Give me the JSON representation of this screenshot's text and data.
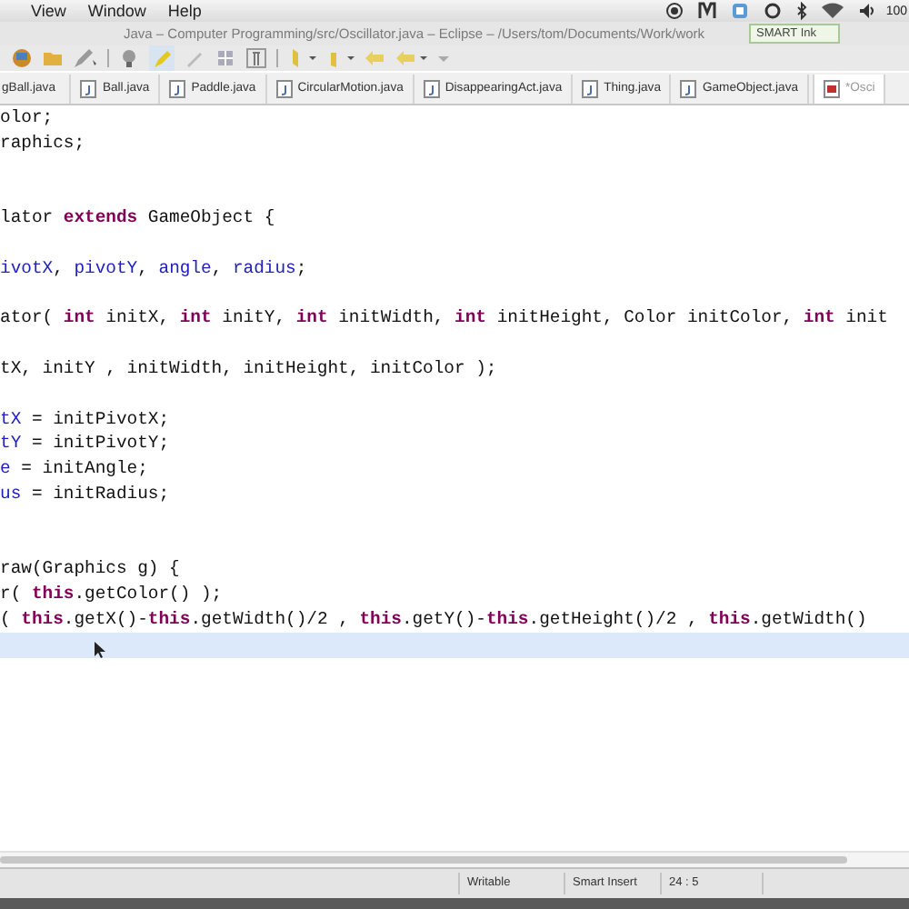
{
  "menu_bar": {
    "items": [
      "View",
      "Window",
      "Help"
    ],
    "battery": "100"
  },
  "window": {
    "title": "Java – Computer Programming/src/Oscillator.java – Eclipse – /Users/tom/Documents/Work/work"
  },
  "smart_ink": {
    "label": "SMART Ink"
  },
  "tabs": [
    {
      "label": "gBall.java",
      "selected": false
    },
    {
      "label": "Ball.java",
      "selected": false
    },
    {
      "label": "Paddle.java",
      "selected": false
    },
    {
      "label": "CircularMotion.java",
      "selected": false
    },
    {
      "label": "DisappearingAct.java",
      "selected": false
    },
    {
      "label": "Thing.java",
      "selected": false
    },
    {
      "label": "GameObject.java",
      "selected": false
    },
    {
      "label": "*Osci",
      "selected": true
    }
  ],
  "editor": {
    "lines": [
      {
        "current": false,
        "segments": [
          {
            "kind": "plain",
            "text": "olor;"
          }
        ]
      },
      {
        "current": false,
        "segments": [
          {
            "kind": "plain",
            "text": "raphics;"
          }
        ]
      },
      {
        "current": false
      },
      {
        "current": false
      },
      {
        "current": false,
        "segments": [
          {
            "kind": "plain",
            "text": "lator "
          },
          {
            "kind": "keyword",
            "text": "extends"
          },
          {
            "kind": "plain",
            "text": " GameObject {"
          }
        ]
      },
      {
        "current": false
      },
      {
        "current": false,
        "segments": [
          {
            "kind": "field",
            "text": "ivotX"
          },
          {
            "kind": "plain",
            "text": ", "
          },
          {
            "kind": "field",
            "text": "pivotY"
          },
          {
            "kind": "plain",
            "text": ", "
          },
          {
            "kind": "field",
            "text": "angle"
          },
          {
            "kind": "plain",
            "text": ", "
          },
          {
            "kind": "field",
            "text": "radius"
          },
          {
            "kind": "plain",
            "text": ";"
          }
        ]
      },
      {
        "current": false
      },
      {
        "current": false,
        "segments": [
          {
            "kind": "plain",
            "text": "ator( "
          },
          {
            "kind": "keyword",
            "text": "int"
          },
          {
            "kind": "plain",
            "text": " initX, "
          },
          {
            "kind": "keyword",
            "text": "int"
          },
          {
            "kind": "plain",
            "text": " initY, "
          },
          {
            "kind": "keyword",
            "text": "int"
          },
          {
            "kind": "plain",
            "text": " initWidth, "
          },
          {
            "kind": "keyword",
            "text": "int"
          },
          {
            "kind": "plain",
            "text": " initHeight, Color initColor, "
          },
          {
            "kind": "keyword",
            "text": "int"
          },
          {
            "kind": "plain",
            "text": " init"
          }
        ]
      },
      {
        "current": false
      },
      {
        "current": false,
        "segments": [
          {
            "kind": "plain",
            "text": "tX, initY , initWidth, initHeight, initColor );"
          }
        ]
      },
      {
        "current": false
      },
      {
        "current": false,
        "segments": [
          {
            "kind": "field",
            "text": "tX"
          },
          {
            "kind": "plain",
            "text": " = initPivotX;"
          }
        ]
      },
      {
        "current": false,
        "segments": [
          {
            "kind": "field",
            "text": "tY"
          },
          {
            "kind": "plain",
            "text": " = initPivotY;"
          }
        ]
      },
      {
        "current": false,
        "segments": [
          {
            "kind": "field",
            "text": "e"
          },
          {
            "kind": "plain",
            "text": " = initAngle;"
          }
        ]
      },
      {
        "current": false,
        "segments": [
          {
            "kind": "field",
            "text": "us"
          },
          {
            "kind": "plain",
            "text": " = initRadius;"
          }
        ]
      },
      {
        "current": false
      },
      {
        "current": false
      },
      {
        "current": false,
        "segments": [
          {
            "kind": "plain",
            "text": "raw(Graphics g) {"
          }
        ]
      },
      {
        "current": false,
        "segments": [
          {
            "kind": "plain",
            "text": "r( "
          },
          {
            "kind": "keyword",
            "text": "this"
          },
          {
            "kind": "plain",
            "text": ".getColor() );"
          }
        ]
      },
      {
        "current": false,
        "segments": [
          {
            "kind": "plain",
            "text": "( "
          },
          {
            "kind": "keyword",
            "text": "this"
          },
          {
            "kind": "plain",
            "text": ".getX()-"
          },
          {
            "kind": "keyword",
            "text": "this"
          },
          {
            "kind": "plain",
            "text": ".getWidth()/2 , "
          },
          {
            "kind": "keyword",
            "text": "this"
          },
          {
            "kind": "plain",
            "text": ".getY()-"
          },
          {
            "kind": "keyword",
            "text": "this"
          },
          {
            "kind": "plain",
            "text": ".getHeight()/2 , "
          },
          {
            "kind": "keyword",
            "text": "this"
          },
          {
            "kind": "plain",
            "text": ".getWidth()"
          }
        ]
      },
      {
        "current": true
      }
    ]
  },
  "status_bar": {
    "fields": [
      "Writable",
      "Smart Insert",
      "24 : 5"
    ]
  }
}
